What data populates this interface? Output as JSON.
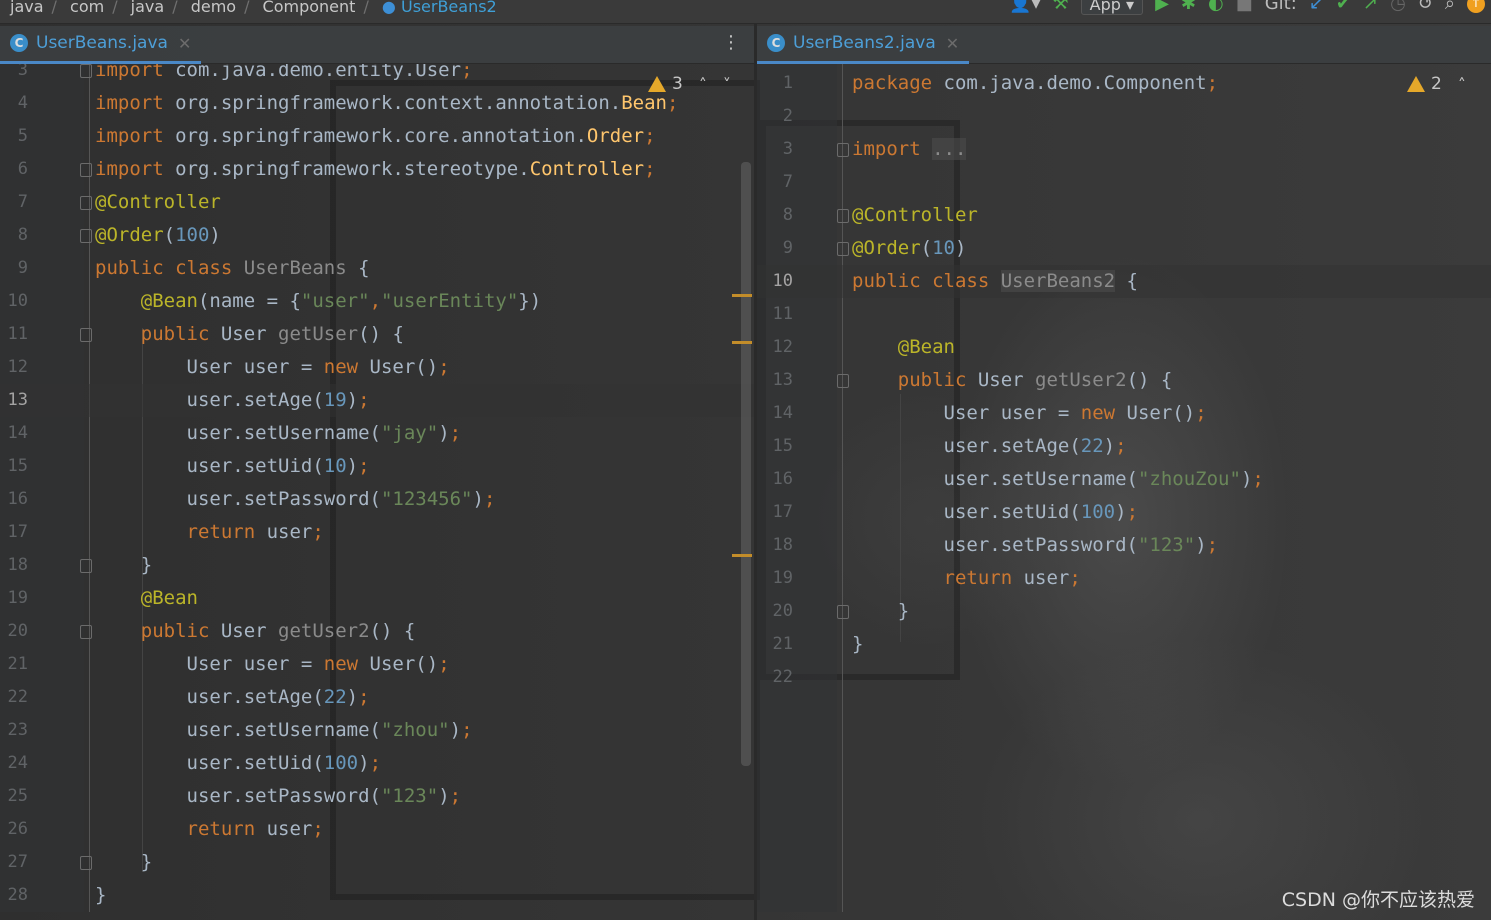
{
  "breadcrumb": [
    "java",
    "com",
    "java",
    "demo",
    "Component",
    "UserBeans2"
  ],
  "toolbar": {
    "run_config": "App",
    "git_label": "Git:"
  },
  "tabs": {
    "left": {
      "file": "UserBeans.java"
    },
    "right": {
      "file": "UserBeans2.java"
    }
  },
  "left_editor": {
    "warning_count": "3",
    "lines": [
      {
        "n": "3",
        "tokens": [
          [
            "kw",
            "import "
          ],
          [
            "pl",
            "com.java.demo.entity.User"
          ],
          [
            "kw",
            ";"
          ]
        ]
      },
      {
        "n": "4",
        "tokens": [
          [
            "kw",
            "import "
          ],
          [
            "pl",
            "org.springframework.context.annotation."
          ],
          [
            "fn",
            "Bean"
          ],
          [
            "kw",
            ";"
          ]
        ]
      },
      {
        "n": "5",
        "tokens": [
          [
            "kw",
            "import "
          ],
          [
            "pl",
            "org.springframework.core.annotation."
          ],
          [
            "fn",
            "Order"
          ],
          [
            "kw",
            ";"
          ]
        ]
      },
      {
        "n": "6",
        "tokens": [
          [
            "kw",
            "import "
          ],
          [
            "pl",
            "org.springframework.stereotype."
          ],
          [
            "fn",
            "Controller"
          ],
          [
            "kw",
            ";"
          ]
        ]
      },
      {
        "n": "7",
        "tokens": [
          [
            "an",
            "@Controller"
          ]
        ]
      },
      {
        "n": "8",
        "tokens": [
          [
            "an",
            "@Order"
          ],
          [
            "pl",
            "("
          ],
          [
            "nm",
            "100"
          ],
          [
            "pl",
            ")"
          ]
        ]
      },
      {
        "n": "9",
        "tokens": [
          [
            "kw",
            "public class "
          ],
          [
            "mt",
            "UserBeans"
          ],
          [
            "pl",
            " {"
          ]
        ]
      },
      {
        "n": "10",
        "tokens": [
          [
            "pl",
            "    "
          ],
          [
            "an",
            "@Bean"
          ],
          [
            "pl",
            "(name = {"
          ],
          [
            "st",
            "\"user\""
          ],
          [
            "kw",
            ","
          ],
          [
            "st",
            "\"userEntity\""
          ],
          [
            "pl",
            "})"
          ]
        ]
      },
      {
        "n": "11",
        "tokens": [
          [
            "pl",
            "    "
          ],
          [
            "kw",
            "public "
          ],
          [
            "pl",
            "User "
          ],
          [
            "mt",
            "getUser"
          ],
          [
            "pl",
            "() {"
          ]
        ]
      },
      {
        "n": "12",
        "tokens": [
          [
            "pl",
            "        User user = "
          ],
          [
            "kw",
            "new "
          ],
          [
            "pl",
            "User()"
          ],
          [
            "kw",
            ";"
          ]
        ]
      },
      {
        "n": "13",
        "tokens": [
          [
            "pl",
            "        user.setAge("
          ],
          [
            "nm",
            "19"
          ],
          [
            "pl",
            ")"
          ],
          [
            "kw",
            ";"
          ]
        ]
      },
      {
        "n": "14",
        "tokens": [
          [
            "pl",
            "        user.setUsername("
          ],
          [
            "st",
            "\"jay\""
          ],
          [
            "pl",
            ")"
          ],
          [
            "kw",
            ";"
          ]
        ]
      },
      {
        "n": "15",
        "tokens": [
          [
            "pl",
            "        user.setUid("
          ],
          [
            "nm",
            "10"
          ],
          [
            "pl",
            ")"
          ],
          [
            "kw",
            ";"
          ]
        ]
      },
      {
        "n": "16",
        "tokens": [
          [
            "pl",
            "        user.setPassword("
          ],
          [
            "st",
            "\"123456\""
          ],
          [
            "pl",
            ")"
          ],
          [
            "kw",
            ";"
          ]
        ]
      },
      {
        "n": "17",
        "tokens": [
          [
            "pl",
            "        "
          ],
          [
            "kw",
            "return "
          ],
          [
            "pl",
            "user"
          ],
          [
            "kw",
            ";"
          ]
        ]
      },
      {
        "n": "18",
        "tokens": [
          [
            "pl",
            "    }"
          ]
        ]
      },
      {
        "n": "19",
        "tokens": [
          [
            "pl",
            "    "
          ],
          [
            "an",
            "@Bean"
          ]
        ]
      },
      {
        "n": "20",
        "tokens": [
          [
            "pl",
            "    "
          ],
          [
            "kw",
            "public "
          ],
          [
            "pl",
            "User "
          ],
          [
            "mt",
            "getUser2"
          ],
          [
            "pl",
            "() {"
          ]
        ]
      },
      {
        "n": "21",
        "tokens": [
          [
            "pl",
            "        User user = "
          ],
          [
            "kw",
            "new "
          ],
          [
            "pl",
            "User()"
          ],
          [
            "kw",
            ";"
          ]
        ]
      },
      {
        "n": "22",
        "tokens": [
          [
            "pl",
            "        user.setAge("
          ],
          [
            "nm",
            "22"
          ],
          [
            "pl",
            ")"
          ],
          [
            "kw",
            ";"
          ]
        ]
      },
      {
        "n": "23",
        "tokens": [
          [
            "pl",
            "        user.setUsername("
          ],
          [
            "st",
            "\"zhou\""
          ],
          [
            "pl",
            ")"
          ],
          [
            "kw",
            ";"
          ]
        ]
      },
      {
        "n": "24",
        "tokens": [
          [
            "pl",
            "        user.setUid("
          ],
          [
            "nm",
            "100"
          ],
          [
            "pl",
            ")"
          ],
          [
            "kw",
            ";"
          ]
        ]
      },
      {
        "n": "25",
        "tokens": [
          [
            "pl",
            "        user.setPassword("
          ],
          [
            "st",
            "\"123\""
          ],
          [
            "pl",
            ")"
          ],
          [
            "kw",
            ";"
          ]
        ]
      },
      {
        "n": "26",
        "tokens": [
          [
            "pl",
            "        "
          ],
          [
            "kw",
            "return "
          ],
          [
            "pl",
            "user"
          ],
          [
            "kw",
            ";"
          ]
        ]
      },
      {
        "n": "27",
        "tokens": [
          [
            "pl",
            "    }"
          ]
        ]
      },
      {
        "n": "28",
        "tokens": [
          [
            "pl",
            "}"
          ]
        ]
      }
    ]
  },
  "right_editor": {
    "warning_count": "2",
    "lines": [
      {
        "n": "1",
        "tokens": [
          [
            "kw",
            "package "
          ],
          [
            "pl",
            "com.java.demo.Component"
          ],
          [
            "kw",
            ";"
          ]
        ]
      },
      {
        "n": "2",
        "tokens": []
      },
      {
        "n": "3",
        "tokens": [
          [
            "kw",
            "import "
          ],
          [
            "mt",
            "..."
          ]
        ]
      },
      {
        "n": "7",
        "tokens": []
      },
      {
        "n": "8",
        "tokens": [
          [
            "an",
            "@Controller"
          ]
        ]
      },
      {
        "n": "9",
        "tokens": [
          [
            "an",
            "@Order"
          ],
          [
            "pl",
            "("
          ],
          [
            "nm",
            "10"
          ],
          [
            "pl",
            ")"
          ]
        ]
      },
      {
        "n": "10",
        "tokens": [
          [
            "kw",
            "public class "
          ],
          [
            "mt",
            "UserBeans2"
          ],
          [
            "pl",
            " {"
          ]
        ]
      },
      {
        "n": "11",
        "tokens": []
      },
      {
        "n": "12",
        "tokens": [
          [
            "pl",
            "    "
          ],
          [
            "an",
            "@Bean"
          ]
        ]
      },
      {
        "n": "13",
        "tokens": [
          [
            "pl",
            "    "
          ],
          [
            "kw",
            "public "
          ],
          [
            "pl",
            "User "
          ],
          [
            "mt",
            "getUser2"
          ],
          [
            "pl",
            "() {"
          ]
        ]
      },
      {
        "n": "14",
        "tokens": [
          [
            "pl",
            "        User user = "
          ],
          [
            "kw",
            "new "
          ],
          [
            "pl",
            "User()"
          ],
          [
            "kw",
            ";"
          ]
        ]
      },
      {
        "n": "15",
        "tokens": [
          [
            "pl",
            "        user.setAge("
          ],
          [
            "nm",
            "22"
          ],
          [
            "pl",
            ")"
          ],
          [
            "kw",
            ";"
          ]
        ]
      },
      {
        "n": "16",
        "tokens": [
          [
            "pl",
            "        user.setUsername("
          ],
          [
            "st",
            "\"zhouZou\""
          ],
          [
            "pl",
            ")"
          ],
          [
            "kw",
            ";"
          ]
        ]
      },
      {
        "n": "17",
        "tokens": [
          [
            "pl",
            "        user.setUid("
          ],
          [
            "nm",
            "100"
          ],
          [
            "pl",
            ")"
          ],
          [
            "kw",
            ";"
          ]
        ]
      },
      {
        "n": "18",
        "tokens": [
          [
            "pl",
            "        user.setPassword("
          ],
          [
            "st",
            "\"123\""
          ],
          [
            "pl",
            ")"
          ],
          [
            "kw",
            ";"
          ]
        ]
      },
      {
        "n": "19",
        "tokens": [
          [
            "pl",
            "        "
          ],
          [
            "kw",
            "return "
          ],
          [
            "pl",
            "user"
          ],
          [
            "kw",
            ";"
          ]
        ]
      },
      {
        "n": "20",
        "tokens": [
          [
            "pl",
            "    }"
          ]
        ]
      },
      {
        "n": "21",
        "tokens": [
          [
            "pl",
            "}"
          ]
        ]
      },
      {
        "n": "22",
        "tokens": []
      }
    ]
  },
  "watermark": "CSDN @你不应该热爱",
  "icons": [
    "user-icon",
    "build-hammer-icon",
    "run-icon",
    "debug-icon",
    "coverage-icon",
    "stop-icon",
    "git-update-icon",
    "git-commit-icon",
    "git-push-icon",
    "history-icon",
    "rollback-icon",
    "search-icon",
    "updates-icon",
    "java-class-icon",
    "close-icon",
    "more-icon",
    "warning-icon",
    "chevron-up-icon",
    "chevron-down-icon",
    "fold-icon"
  ],
  "colors": {
    "keyword": "#cc7832",
    "annotation": "#bbb529",
    "string": "#6a8759",
    "number": "#6897bb",
    "method_decl": "#8b8b8b",
    "plain": "#a9b7c6",
    "accent": "#4a88c7",
    "warning": "#e5a82a"
  }
}
